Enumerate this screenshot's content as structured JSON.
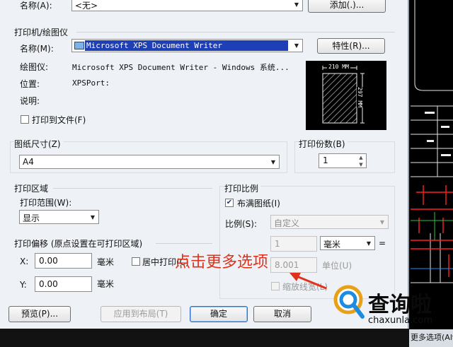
{
  "page_setup": {
    "name_label": "名称(A):",
    "name_value": "<无>",
    "add_button": "添加(.)..."
  },
  "printer": {
    "group_title": "打印机/绘图仪",
    "name_label": "名称(M):",
    "name_value": "Microsoft XPS Document Writer",
    "properties_button": "特性(R)...",
    "plotter_label": "绘图仪:",
    "plotter_value": "Microsoft XPS Document Writer - Windows 系统...",
    "location_label": "位置:",
    "location_value": "XPSPort:",
    "desc_label": "说明:",
    "print_to_file_label": "打印到文件(F)",
    "preview_width": "210 MM",
    "preview_height": "297 MM"
  },
  "paper": {
    "group_title": "图纸尺寸(Z)",
    "value": "A4"
  },
  "copies": {
    "group_title": "打印份数(B)",
    "value": "1"
  },
  "plot_area": {
    "group_title": "打印区域",
    "range_label": "打印范围(W):",
    "range_value": "显示"
  },
  "plot_offset": {
    "group_title": "打印偏移 (原点设置在可打印区域)",
    "x_label": "X:",
    "x_value": "0.00",
    "x_unit": "毫米",
    "center_label": "居中打印(C)",
    "y_label": "Y:",
    "y_value": "0.00",
    "y_unit": "毫米"
  },
  "plot_scale": {
    "group_title": "打印比例",
    "fit_label": "布满图纸(I)",
    "scale_label": "比例(S):",
    "scale_value": "自定义",
    "value1": "1",
    "unit_value": "毫米",
    "equals": "=",
    "value2": "8.001",
    "unit_label": "单位(U)",
    "lineweights_label": "缩放线宽(L)"
  },
  "buttons": {
    "preview": "预览(P)...",
    "apply_layout": "应用到布局(T)",
    "ok": "确定",
    "cancel": "取消"
  },
  "annotation": "点击更多选项",
  "watermark": {
    "brand": "查询啦",
    "url": "chaxunla.com"
  },
  "status_strip": "更多选项(Alt +",
  "colors": {
    "selection": "#1f3fb6",
    "annotation": "#e0321b",
    "dialog_bg": "#eef1f5"
  }
}
